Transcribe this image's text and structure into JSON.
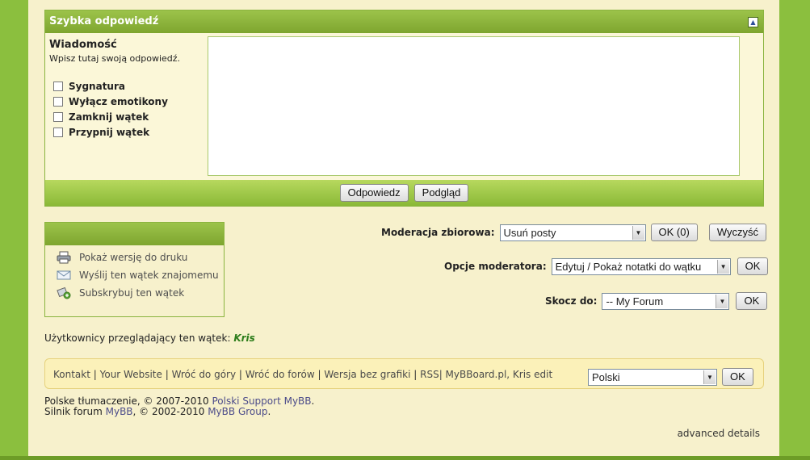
{
  "quick_reply": {
    "title": "Szybka odpowiedź",
    "message_label": "Wiadomość",
    "message_hint": "Wpisz tutaj swoją odpowiedź.",
    "options": [
      "Sygnatura",
      "Wyłącz emotikony",
      "Zamknij wątek",
      "Przypnij wątek"
    ],
    "reply_button": "Odpowiedz",
    "preview_button": "Podgląd"
  },
  "thread_tools": {
    "items": [
      {
        "label": "Pokaż wersję do druku",
        "icon": "printer-icon"
      },
      {
        "label": "Wyślij ten wątek znajomemu",
        "icon": "mail-icon"
      },
      {
        "label": "Subskrybuj ten wątek",
        "icon": "subscribe-icon"
      }
    ]
  },
  "moderation": {
    "bulk_label": "Moderacja zbiorowa:",
    "bulk_value": "Usuń posty",
    "bulk_ok": "OK (0)",
    "bulk_clear": "Wyczyść",
    "mod_label": "Opcje moderatora:",
    "mod_value": "Edytuj / Pokaż notatki do wątku",
    "mod_ok": "OK",
    "jump_label": "Skocz do:",
    "jump_value": "-- My Forum",
    "jump_ok": "OK"
  },
  "viewers": {
    "label": "Użytkownicy przeglądający ten wątek:",
    "user": "Kris"
  },
  "footer": {
    "links": [
      "Kontakt",
      "Your Website",
      "Wróć do góry",
      "Wróć do forów",
      "Wersja bez grafiki",
      "RSS| MyBBoard.pl, Kris edit"
    ],
    "language_value": "Polski",
    "language_ok": "OK"
  },
  "copyright": {
    "line1_prefix": "Polske tłumaczenie, © 2007-2010 ",
    "line1_link": "Polski Support MyBB",
    "line1_suffix": ".",
    "line2_prefix": "Silnik forum ",
    "line2_link1": "MyBB",
    "line2_mid": ", © 2002-2010 ",
    "line2_link2": "MyBB Group",
    "line2_suffix": "."
  },
  "advanced": "advanced details"
}
